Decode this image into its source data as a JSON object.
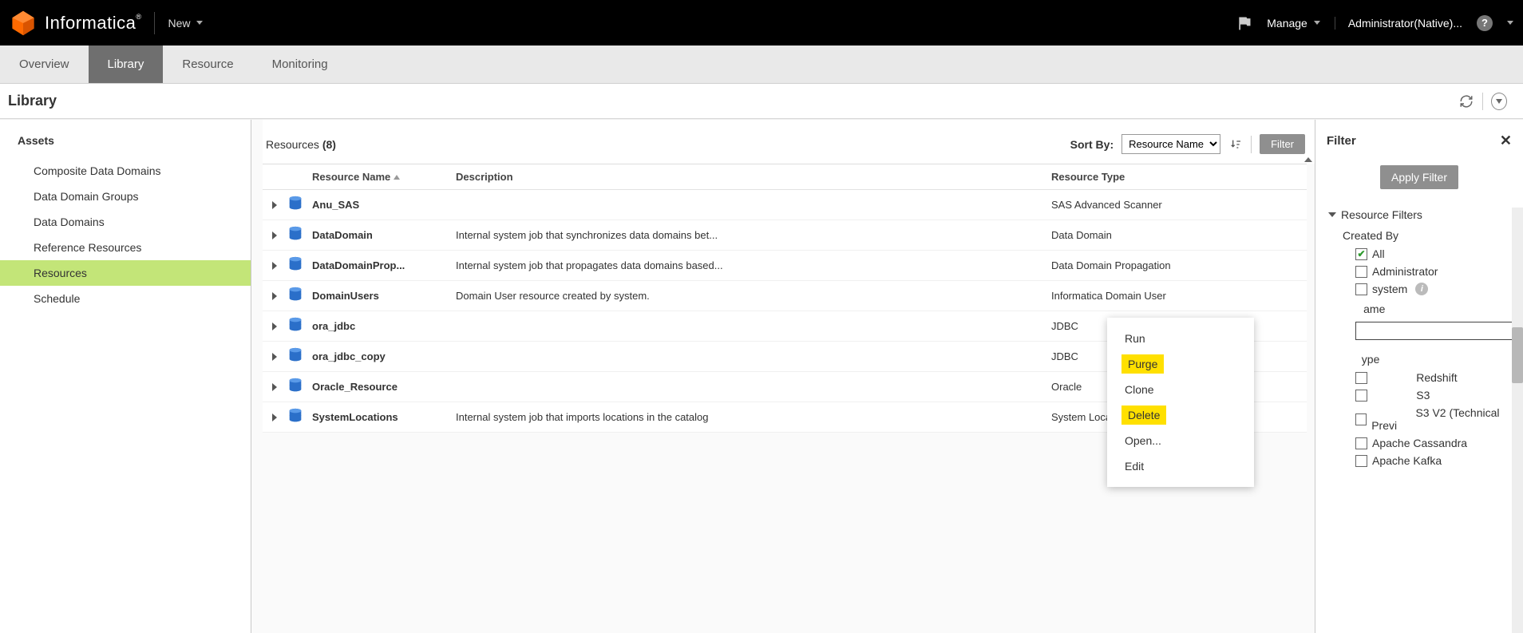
{
  "topbar": {
    "brand": "Informatica",
    "new_label": "New",
    "manage_label": "Manage",
    "user_label": "Administrator(Native)..."
  },
  "tabs": [
    {
      "label": "Overview",
      "active": false
    },
    {
      "label": "Library",
      "active": true
    },
    {
      "label": "Resource",
      "active": false
    },
    {
      "label": "Monitoring",
      "active": false
    }
  ],
  "page_title": "Library",
  "assets": {
    "heading": "Assets",
    "items": [
      {
        "label": "Composite Data Domains",
        "active": false
      },
      {
        "label": "Data Domain Groups",
        "active": false
      },
      {
        "label": "Data Domains",
        "active": false
      },
      {
        "label": "Reference Resources",
        "active": false
      },
      {
        "label": "Resources",
        "active": true
      },
      {
        "label": "Schedule",
        "active": false
      }
    ]
  },
  "resources": {
    "label": "Resources",
    "count": "(8)",
    "sort_by_label": "Sort By:",
    "sort_by_value": "Resource Name",
    "filter_btn": "Filter",
    "columns": {
      "name": "Resource Name",
      "desc": "Description",
      "type": "Resource Type"
    },
    "rows": [
      {
        "name": "Anu_SAS",
        "desc": "",
        "type": "SAS Advanced Scanner"
      },
      {
        "name": "DataDomain",
        "desc": "Internal system job that synchronizes data domains bet...",
        "type": "Data Domain"
      },
      {
        "name": "DataDomainProp...",
        "desc": "Internal system job that propagates data domains based...",
        "type": "Data Domain Propagation"
      },
      {
        "name": "DomainUsers",
        "desc": "Domain User resource created by system.",
        "type": "Informatica Domain User"
      },
      {
        "name": "ora_jdbc",
        "desc": "",
        "type": "JDBC"
      },
      {
        "name": "ora_jdbc_copy",
        "desc": "",
        "type": "JDBC"
      },
      {
        "name": "Oracle_Resource",
        "desc": "",
        "type": "Oracle"
      },
      {
        "name": "SystemLocations",
        "desc": "Internal system job that imports locations in the catalog",
        "type": "System Location"
      }
    ]
  },
  "context_menu": {
    "items": [
      {
        "label": "Run",
        "highlight": false
      },
      {
        "label": "Purge",
        "highlight": true
      },
      {
        "label": "Clone",
        "highlight": false
      },
      {
        "label": "Delete",
        "highlight": true
      },
      {
        "label": "Open...",
        "highlight": false
      },
      {
        "label": "Edit",
        "highlight": false
      }
    ]
  },
  "filter_panel": {
    "title": "Filter",
    "apply_btn": "Apply Filter",
    "group_title": "Resource Filters",
    "created_by_label": "Created By",
    "created_by_options": [
      {
        "label": "All",
        "checked": true
      },
      {
        "label": "Administrator",
        "checked": false
      },
      {
        "label": "system",
        "checked": false,
        "info": true
      }
    ],
    "name_label": "ame",
    "type_label": "ype",
    "types": [
      {
        "label": "Redshift",
        "prefix": true
      },
      {
        "label": "S3",
        "prefix": true
      },
      {
        "label": "S3 V2 (Technical Previ",
        "prefix": true
      },
      {
        "label": "Apache Cassandra",
        "prefix": false
      },
      {
        "label": "Apache Kafka",
        "prefix": false
      }
    ]
  }
}
